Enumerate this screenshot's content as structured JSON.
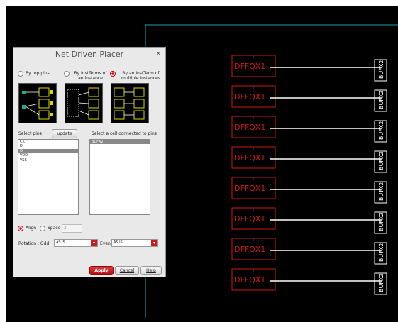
{
  "dialog": {
    "title": "Net Driven Placer",
    "close_glyph": "×",
    "radios": [
      {
        "label": "By top pins",
        "selected": false
      },
      {
        "label": "By instTerms of an instance",
        "selected": false
      },
      {
        "label": "By an instTerm of multiple instances",
        "selected": true
      }
    ],
    "thumbnails": [
      {
        "icon": "top-pins-diagram-icon"
      },
      {
        "icon": "instance-terms-diagram-icon"
      },
      {
        "icon": "multi-instance-terms-diagram-icon"
      }
    ],
    "select_pins_label": "Select pins",
    "update_label": "update",
    "select_cell_label": "Select a cell connected to pins",
    "pins": [
      "CK",
      "D",
      "Q",
      "VDD",
      "VSS"
    ],
    "selected_pin": "Q",
    "cells": [
      "BUFX2"
    ],
    "align_label": "Align",
    "align_selected": true,
    "space_label": "Space",
    "space_value": "2",
    "rotation_odd_label": "Rotation : Odd",
    "rotation_odd_value": "AS IS",
    "even_label": "Even",
    "even_value": "AS IS",
    "apply_label": "Apply",
    "cancel_label": "Cancel",
    "help_label": "Help"
  },
  "canvas": {
    "instances": [
      "DFFQX1",
      "DFFQX1",
      "DFFQX1",
      "DFFQX1",
      "DFFQX1",
      "DFFQX1",
      "DFFQX1",
      "DFFQX1"
    ],
    "buffers": [
      "BUFX2",
      "BUFX2",
      "BUFX2",
      "BUFX2",
      "BUFX2",
      "BUFX2",
      "BUFX2",
      "BUFX2"
    ],
    "colors": {
      "background": "#000000",
      "boundary": "#20a0b0",
      "instance": "#d01818",
      "buffer": "#ffffff",
      "net": "#ffffff"
    }
  }
}
